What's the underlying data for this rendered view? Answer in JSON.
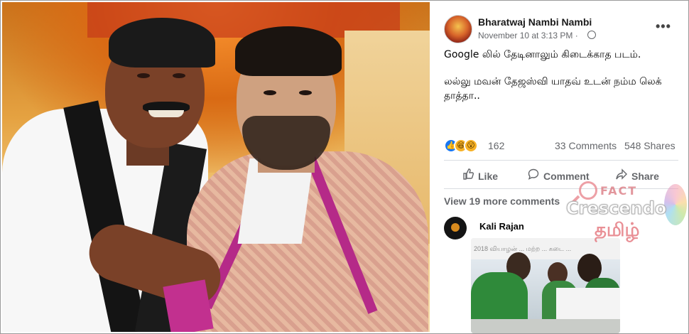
{
  "post": {
    "author": "Bharatwaj Nambi Nambi",
    "timestamp": "November 10 at 3:13 PM",
    "privacy_separator": "·",
    "more_label": "•••",
    "text_line1": "Google லில் தேடினாலும் கிடைக்காத படம்.",
    "text_line2": "லல்லு மவன் தேஜஸ்வி யாதவ் உடன் நம்ம லெக் தாத்தா.."
  },
  "reactions": {
    "count": "162",
    "comments": "33 Comments",
    "shares": "548 Shares",
    "like_glyph": "👍",
    "haha_glyph": "😆",
    "wow_glyph": "😮"
  },
  "actions": {
    "like": "Like",
    "comment": "Comment",
    "share": "Share"
  },
  "comments": {
    "view_more": "View 19 more comments",
    "first_author": "Kali Rajan",
    "photo_banner": "2018 வியாழன் ... மற்ற ... கடை ..."
  },
  "watermark": {
    "fact": "FACT",
    "brand": "Crescendo",
    "language": "தமிழ்"
  },
  "colors": {
    "accent_blue": "#1877f2",
    "secondary_text": "#65676b",
    "watermark_pink": "#e26b73"
  },
  "icons": {
    "like": "thumbs-up-icon",
    "comment": "speech-bubble-icon",
    "share": "share-arrow-icon",
    "privacy": "globe-icon"
  }
}
